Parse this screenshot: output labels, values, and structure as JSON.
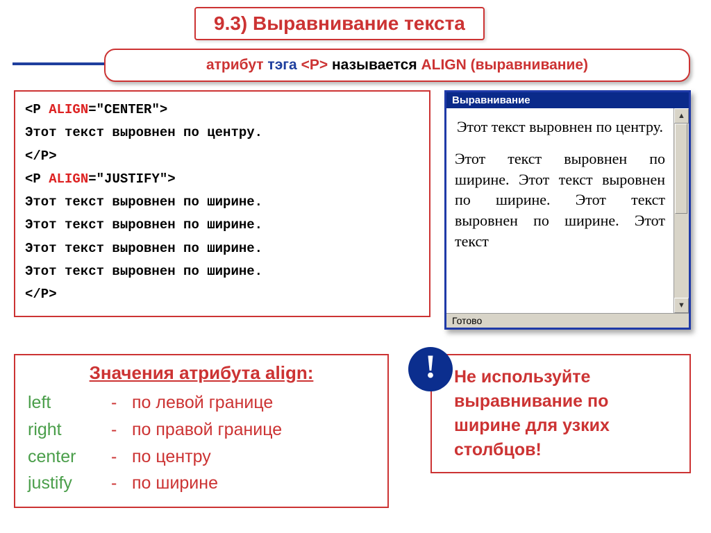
{
  "title": "9.3) Выравнивание текста",
  "subtitle": {
    "w1": "атрибут",
    "w2": "тэга",
    "tag": "<P>",
    "w3": "называется",
    "w4": "ALIGN (выравнивание)"
  },
  "code": {
    "l1a": "<P ",
    "l1b": "ALIGN",
    "l1c": "=\"CENTER\">",
    "l2": "Этот текст выровнен по центру.",
    "l3": "</P>",
    "l4a": "<P ",
    "l4b": "ALIGN",
    "l4c": "=\"JUSTIFY\">",
    "l5": "Этот текст выровнен по ширине.",
    "l6": "Этот текст выровнен по ширине.",
    "l7": "Этот текст выровнен по ширине.",
    "l8": "Этот текст выровнен по ширине.",
    "l9": "</P>"
  },
  "browser": {
    "title": "Выравнивание",
    "center": "Этот текст выровнен по центру.",
    "justify": "Этот текст выровнен по ширине. Этот текст выровнен по ширине. Этот текст выровнен по ширине. Этот текст",
    "status": "Готово"
  },
  "values": {
    "header": "Значения атрибута align:",
    "rows": [
      {
        "key": "left",
        "desc": "по левой границе"
      },
      {
        "key": "right",
        "desc": "по правой границе"
      },
      {
        "key": "center",
        "desc": "по центру"
      },
      {
        "key": "justify",
        "desc": "по ширине"
      }
    ]
  },
  "warn": {
    "mark": "!",
    "text": "Не используйте выравнивание по ширине для узких столбцов!"
  }
}
